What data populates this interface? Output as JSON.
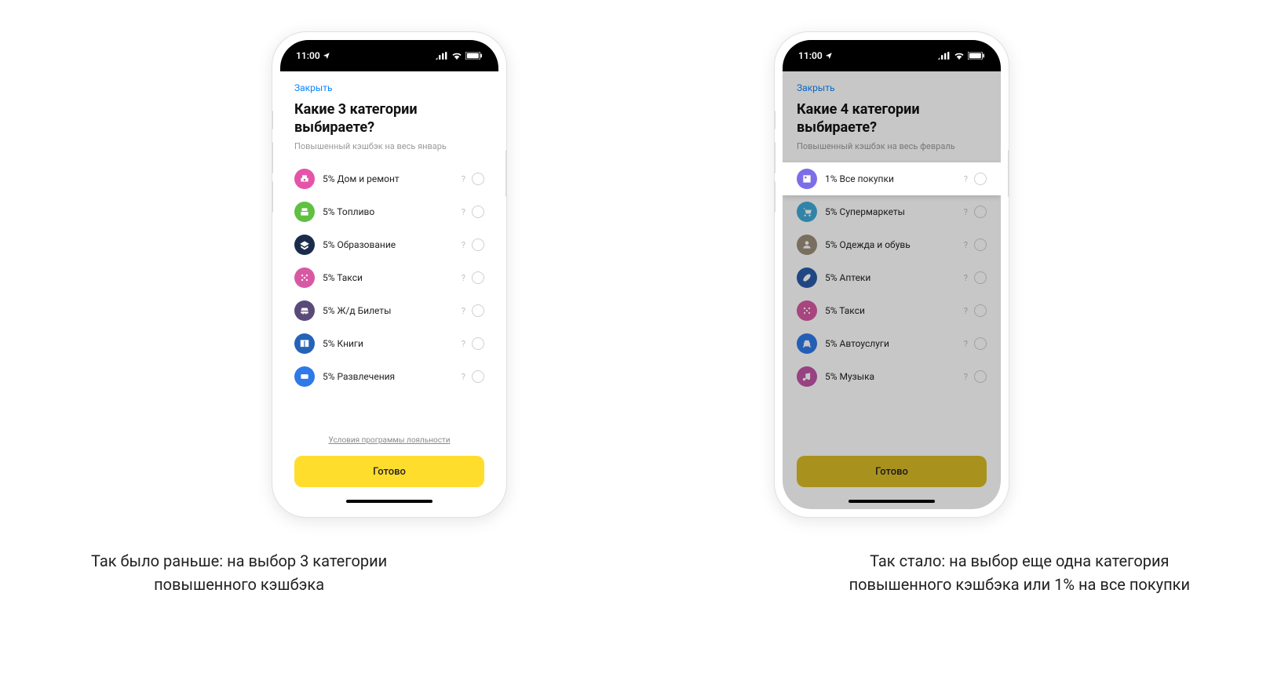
{
  "status": {
    "time": "11:00"
  },
  "phone1": {
    "close": "Закрыть",
    "title_line1": "Какие 3 категории",
    "title_line2": "выбираете?",
    "subtitle": "Повышенный кэшбэк на весь январь",
    "items": [
      {
        "label": "5% Дом и ремонт",
        "color": "#e554a8"
      },
      {
        "label": "5% Топливо",
        "color": "#5fc041"
      },
      {
        "label": "5% Образование",
        "color": "#1a2c4a"
      },
      {
        "label": "5% Такси",
        "color": "#d859a3"
      },
      {
        "label": "5% Ж/д Билеты",
        "color": "#5a4a7a"
      },
      {
        "label": "5% Книги",
        "color": "#2563b6"
      },
      {
        "label": "5% Развлечения",
        "color": "#2d7ae8"
      }
    ],
    "terms": "Условия программы лояльности",
    "done": "Готово",
    "caption": "Так было раньше: на выбор 3 категории\nповышенного кэшбэка"
  },
  "phone2": {
    "close": "Закрыть",
    "title_line1": "Какие 4 категории",
    "title_line2": "выбираете?",
    "subtitle": "Повышенный кэшбэк на весь февраль",
    "items": [
      {
        "label": "1% Все покупки",
        "color": "#7c6ee8",
        "highlighted": true
      },
      {
        "label": "5% Супермаркеты",
        "color": "#3fa9d8"
      },
      {
        "label": "5% Одежда и обувь",
        "color": "#9c8d7a"
      },
      {
        "label": "5% Аптеки",
        "color": "#2a5ba8"
      },
      {
        "label": "5% Такси",
        "color": "#d859a3"
      },
      {
        "label": "5% Автоуслуги",
        "color": "#2d7ae8"
      },
      {
        "label": "5% Музыка",
        "color": "#c055a8"
      }
    ],
    "terms": "",
    "done": "Готово",
    "caption": "Так стало: на выбор еще одна категория\nповышенного кэшбэка или 1% на все покупки"
  }
}
